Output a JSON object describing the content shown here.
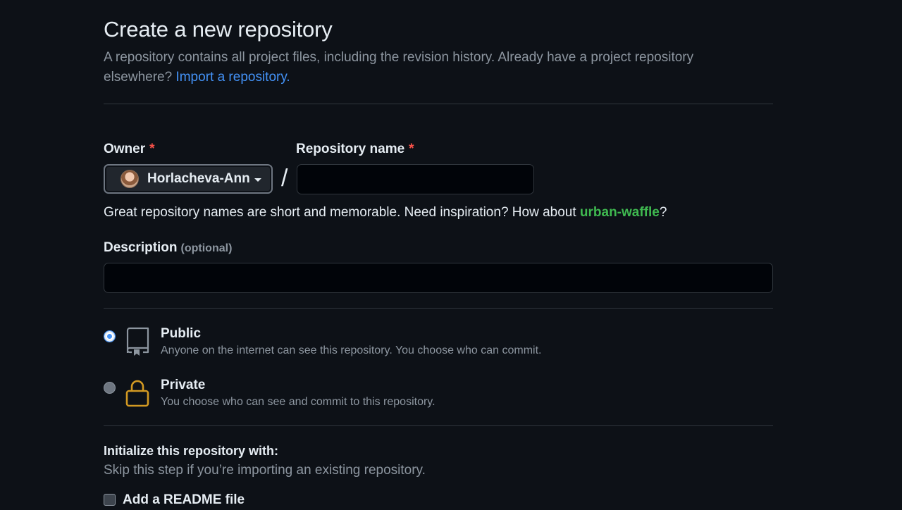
{
  "page": {
    "title": "Create a new repository",
    "subtitle": "A repository contains all project files, including the revision history. Already have a project repository elsewhere?",
    "import_link": "Import a repository."
  },
  "owner": {
    "label": "Owner",
    "required_mark": "*",
    "selected": "Horlacheva-Ann"
  },
  "repo": {
    "label": "Repository name",
    "required_mark": "*",
    "value": "",
    "separator": "/"
  },
  "hint": {
    "text": "Great repository names are short and memorable. Need inspiration? How about ",
    "suggestion": "urban-waffle",
    "suffix": "?"
  },
  "description": {
    "label": "Description",
    "optional": "(optional)",
    "value": ""
  },
  "visibility": {
    "selected": "public",
    "options": [
      {
        "key": "public",
        "title": "Public",
        "desc": "Anyone on the internet can see this repository. You choose who can commit.",
        "icon": "repo-icon"
      },
      {
        "key": "private",
        "title": "Private",
        "desc": "You choose who can see and commit to this repository.",
        "icon": "lock-icon"
      }
    ]
  },
  "initialize": {
    "title": "Initialize this repository with:",
    "subtitle": "Skip this step if you’re importing an existing repository.",
    "readme_label": "Add a README file",
    "readme_checked": false
  },
  "colors": {
    "background": "#0d1117",
    "link": "#4493f8",
    "suggestion": "#3fb950",
    "required": "#f85149",
    "lock": "#d29922"
  }
}
